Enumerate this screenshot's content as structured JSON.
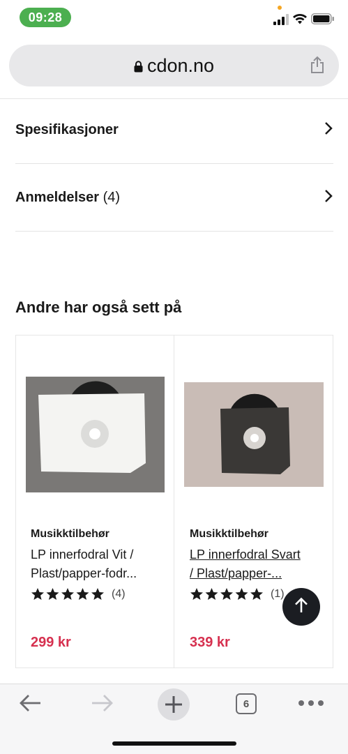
{
  "status": {
    "time": "09:28"
  },
  "browser": {
    "url": "cdon.no"
  },
  "accordion": [
    {
      "label": "Spesifikasjoner",
      "count": ""
    },
    {
      "label": "Anmeldelser",
      "count": "(4)"
    }
  ],
  "section": {
    "title": "Andre har også sett på"
  },
  "products": [
    {
      "category": "Musikktilbehør",
      "title_line1": "LP innerfodral Vit /",
      "title_line2": "Plast/papper-fodr...",
      "rating_count": "(4)",
      "stars": 5,
      "price": "299 kr"
    },
    {
      "category": "Musikktilbehør",
      "title_line1": "LP innerfodral Svart",
      "title_line2": "/ Plast/papper-...",
      "rating_count": "(1)",
      "stars": 5,
      "price": "339 kr"
    }
  ],
  "toolbar": {
    "tab_count": "6"
  },
  "colors": {
    "price": "#d6304f",
    "time_pill": "#4caf50",
    "fab": "#1b1d22"
  }
}
